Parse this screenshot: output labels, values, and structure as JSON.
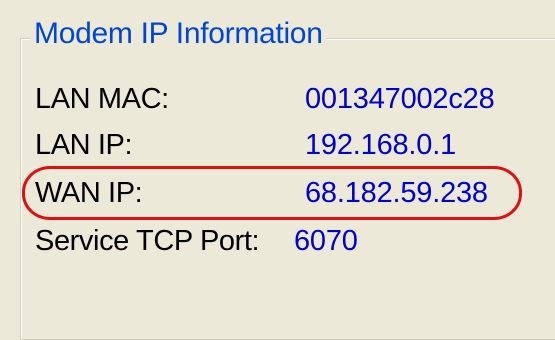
{
  "group": {
    "title": "Modem IP Information"
  },
  "rows": [
    {
      "label": "LAN MAC:",
      "value": "001347002c28"
    },
    {
      "label": "LAN IP:",
      "value": "192.168.0.1"
    },
    {
      "label": "WAN IP:",
      "value": "68.182.59.238"
    },
    {
      "label": "Service TCP Port:",
      "value": "6070"
    }
  ],
  "highlight": {
    "target": "WAN IP",
    "color": "#e01010"
  },
  "colors": {
    "title": "#0046d5",
    "value": "#0000cc",
    "background": "#ece9d8"
  }
}
